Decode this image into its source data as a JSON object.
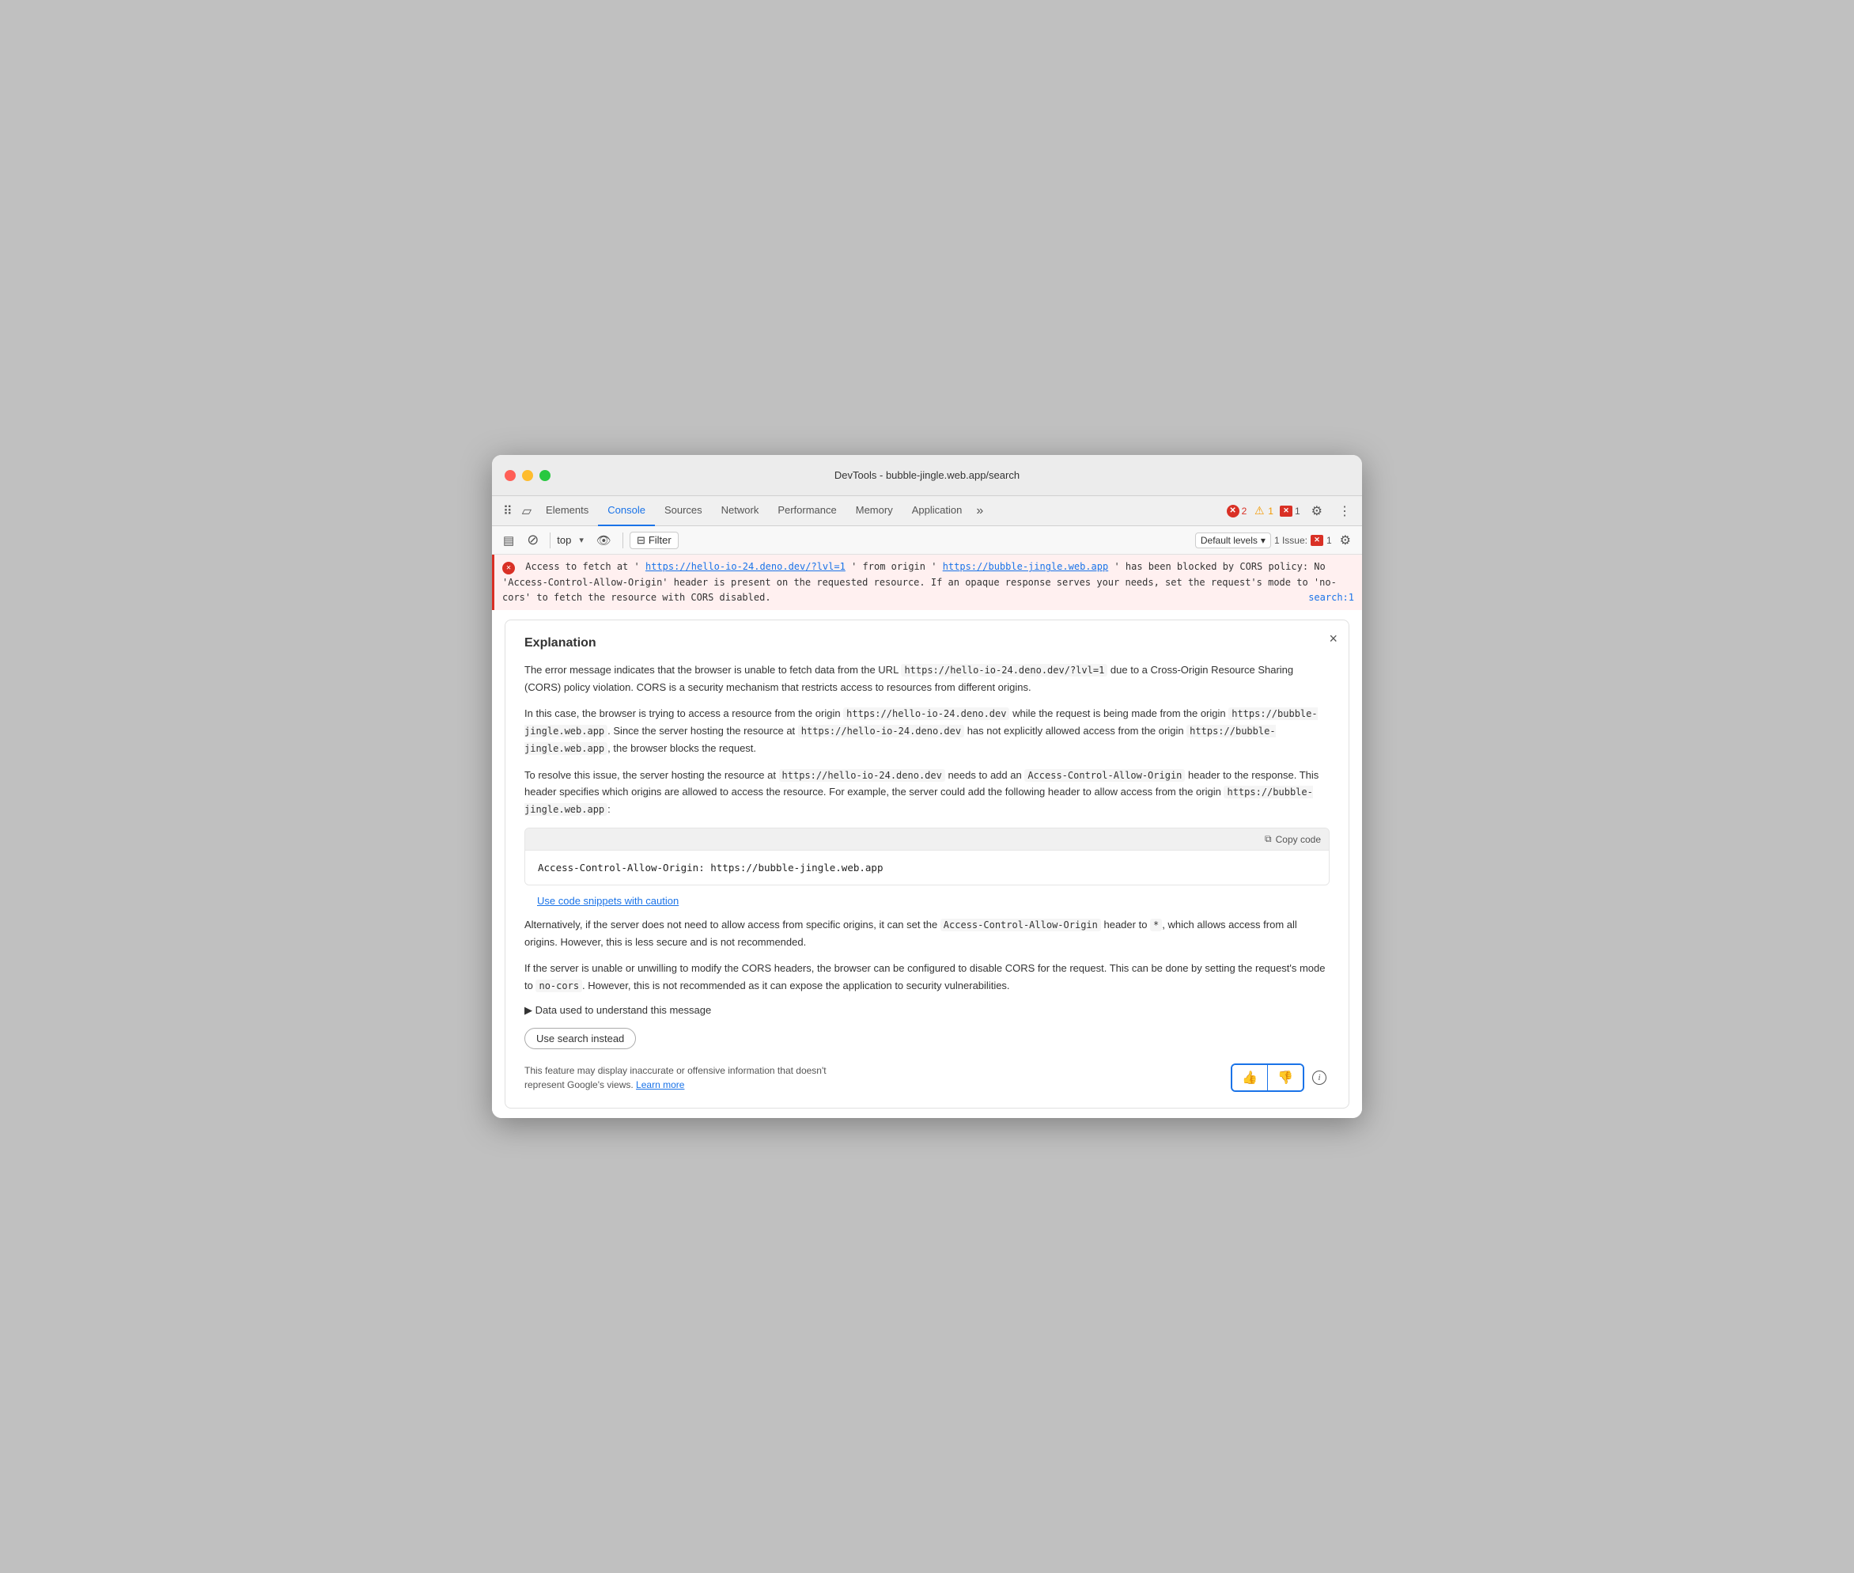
{
  "window": {
    "title": "DevTools - bubble-jingle.web.app/search"
  },
  "tabs": [
    {
      "id": "elements",
      "label": "Elements",
      "active": false
    },
    {
      "id": "console",
      "label": "Console",
      "active": true
    },
    {
      "id": "sources",
      "label": "Sources",
      "active": false
    },
    {
      "id": "network",
      "label": "Network",
      "active": false
    },
    {
      "id": "performance",
      "label": "Performance",
      "active": false
    },
    {
      "id": "memory",
      "label": "Memory",
      "active": false
    },
    {
      "id": "application",
      "label": "Application",
      "active": false
    }
  ],
  "status": {
    "error_count": "2",
    "warning_count": "1",
    "info_count": "1",
    "issue_count": "1 Issue:",
    "issue_badge": "1"
  },
  "toolbar": {
    "context": "top",
    "filter_label": "Filter",
    "levels_label": "Default levels",
    "levels_arrow": "▾"
  },
  "error_message": {
    "prefix": "Access to fetch at '",
    "url1": "https://hello-io-24.deno.dev/?lvl=1",
    "middle1": "' from origin '",
    "url2": "https://bubble-jingle.web.app",
    "middle2": "' has been blocked by CORS policy: No 'Access-Control-Allow-Origin' header is present on the requested resource. If an opaque response serves your needs, set the request's mode to 'no-cors' to fetch the resource with CORS disabled.",
    "source_link": "search:1"
  },
  "explanation": {
    "title": "Explanation",
    "paragraphs": [
      "The error message indicates that the browser is unable to fetch data from the URL https://hello-io-24.deno.dev/?lvl=1 due to a Cross-Origin Resource Sharing (CORS) policy violation. CORS is a security mechanism that restricts access to resources from different origins.",
      "In this case, the browser is trying to access a resource from the origin https://hello-io-24.deno.dev while the request is being made from the origin https://bubble-jingle.web.app. Since the server hosting the resource at https://hello-io-24.deno.dev has not explicitly allowed access from the origin https://bubble-jingle.web.app, the browser blocks the request.",
      "To resolve this issue, the server hosting the resource at https://hello-io-24.deno.dev needs to add an Access-Control-Allow-Origin header to the response. This header specifies which origins are allowed to access the resource. For example, the server could add the following header to allow access from the origin https://bubble-jingle.web.app:"
    ],
    "code_snippet": "Access-Control-Allow-Origin: https://bubble-jingle.web.app",
    "copy_code_label": "Copy code",
    "caution_label": "Use code snippets with caution",
    "paragraphs2": [
      "Alternatively, if the server does not need to allow access from specific origins, it can set the Access-Control-Allow-Origin header to *, which allows access from all origins. However, this is less secure and is not recommended.",
      "If the server is unable or unwilling to modify the CORS headers, the browser can be configured to disable CORS for the request. This can be done by setting the request's mode to no-cors. However, this is not recommended as it can expose the application to security vulnerabilities."
    ],
    "data_section_label": "▶ Data used to understand this message",
    "use_search_label": "Use search instead",
    "disclaimer": "This feature may display inaccurate or offensive information that doesn't represent Google's views.",
    "learn_more": "Learn more"
  }
}
